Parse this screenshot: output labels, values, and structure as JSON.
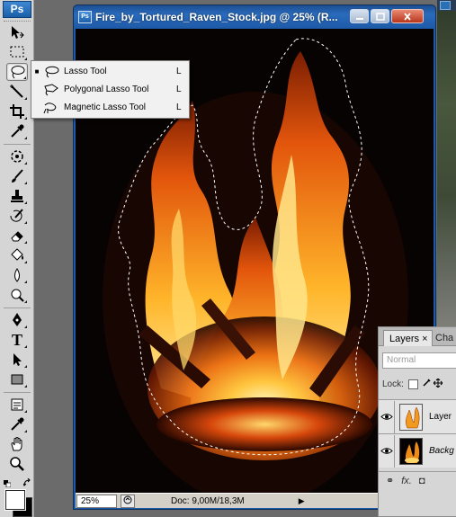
{
  "app": {
    "logo": "Ps",
    "background_colors": {
      "workspace": "#6b6b6b",
      "titlebar": "#1d59a6",
      "panel": "#d6d6d6"
    }
  },
  "toolbox": {
    "tools": [
      {
        "name": "move-tool",
        "icon": "move-icon"
      },
      {
        "name": "marquee-tool",
        "icon": "rect-marquee-icon"
      },
      {
        "name": "lasso-tool",
        "icon": "lasso-icon",
        "active": true
      },
      {
        "name": "quick-select-tool",
        "icon": "magic-wand-icon"
      },
      {
        "name": "crop-tool",
        "icon": "crop-icon"
      },
      {
        "name": "eyedropper-tool",
        "icon": "eyedropper-icon"
      },
      {
        "name": "healing-tool",
        "icon": "healing-icon"
      },
      {
        "name": "brush-tool",
        "icon": "brush-icon"
      },
      {
        "name": "stamp-tool",
        "icon": "stamp-icon"
      },
      {
        "name": "history-brush-tool",
        "icon": "history-brush-icon"
      },
      {
        "name": "eraser-tool",
        "icon": "eraser-icon"
      },
      {
        "name": "paint-bucket-tool",
        "icon": "paint-bucket-icon"
      },
      {
        "name": "blur-tool",
        "icon": "drop-icon"
      },
      {
        "name": "dodge-tool",
        "icon": "dodge-icon"
      },
      {
        "name": "pen-tool",
        "icon": "pen-icon"
      },
      {
        "name": "type-tool",
        "icon": "type-icon"
      },
      {
        "name": "path-select-tool",
        "icon": "arrow-icon"
      },
      {
        "name": "shape-tool",
        "icon": "rectangle-shape-icon"
      },
      {
        "name": "notes-tool",
        "icon": "notes-icon"
      },
      {
        "name": "eyedropper2-tool",
        "icon": "eyedropper-icon"
      },
      {
        "name": "hand-tool",
        "icon": "hand-icon"
      },
      {
        "name": "zoom-tool",
        "icon": "zoom-icon"
      }
    ],
    "type_glyph": "T",
    "foreground_color": "#ffffff",
    "background_color": "#000000"
  },
  "flyout": {
    "items": [
      {
        "label": "Lasso Tool",
        "shortcut": "L",
        "selected": true,
        "icon": "lasso-icon"
      },
      {
        "label": "Polygonal Lasso Tool",
        "shortcut": "L",
        "selected": false,
        "icon": "polygonal-lasso-icon"
      },
      {
        "label": "Magnetic Lasso Tool",
        "shortcut": "L",
        "selected": false,
        "icon": "magnetic-lasso-icon"
      }
    ],
    "bullet": "■"
  },
  "document": {
    "title": "Fire_by_Tortured_Raven_Stock.jpg @ 25% (R...",
    "ps_icon": "Ps",
    "zoom": "25%",
    "doc_info": "Doc: 9,00M/18,3M",
    "status_arrow": "▶",
    "scroll_arrow": "◀"
  },
  "layers_panel": {
    "tabs": {
      "layers": "Layers",
      "close": "×",
      "channels": "Cha"
    },
    "blend_mode": "Normal",
    "lock_label": "Lock:",
    "layers": [
      {
        "name": "Layer",
        "italic": false,
        "visible": true
      },
      {
        "name": "Backg",
        "italic": true,
        "visible": true
      }
    ],
    "footer": {
      "link": "⚭",
      "fx": "fx.",
      "mask": "◘"
    }
  }
}
